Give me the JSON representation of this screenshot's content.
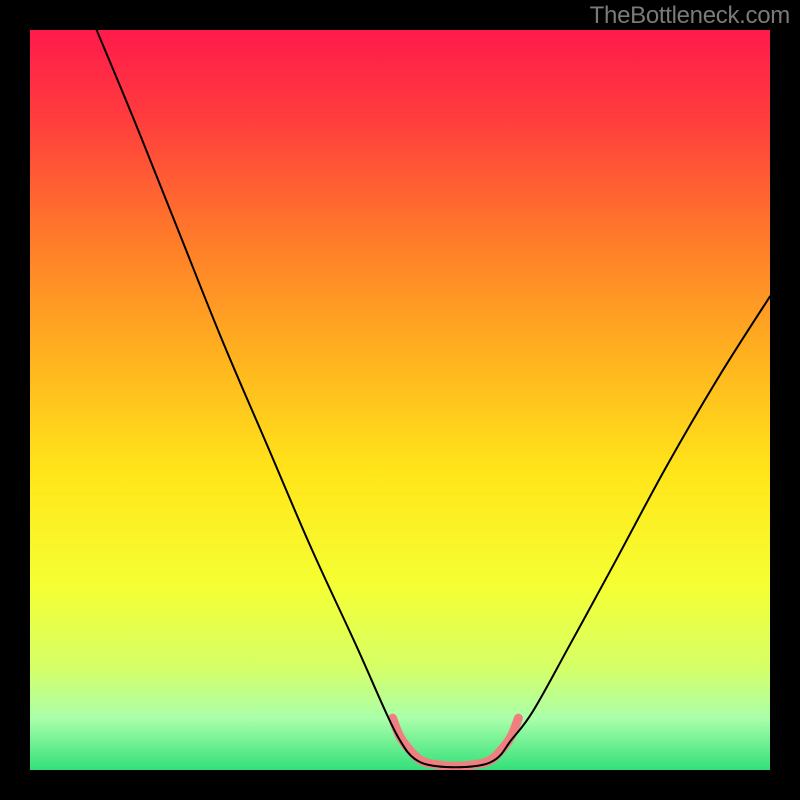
{
  "watermark": "TheBottleneck.com",
  "chart_data": {
    "type": "line",
    "title": "",
    "xlabel": "",
    "ylabel": "",
    "xlim": [
      0,
      100
    ],
    "ylim": [
      0,
      100
    ],
    "background_gradient": {
      "stops": [
        {
          "offset": 0.0,
          "color": "#ff1a4b"
        },
        {
          "offset": 0.12,
          "color": "#ff3d3d"
        },
        {
          "offset": 0.28,
          "color": "#ff7a2a"
        },
        {
          "offset": 0.44,
          "color": "#ffb21f"
        },
        {
          "offset": 0.6,
          "color": "#ffe61a"
        },
        {
          "offset": 0.75,
          "color": "#f5ff33"
        },
        {
          "offset": 0.86,
          "color": "#d6ff66"
        },
        {
          "offset": 0.93,
          "color": "#aaffaa"
        },
        {
          "offset": 1.0,
          "color": "#33e07a"
        }
      ]
    },
    "series": [
      {
        "name": "curve",
        "color": "#000000",
        "width": 2,
        "points": [
          {
            "x": 9.0,
            "y": 100.0
          },
          {
            "x": 14.0,
            "y": 88.0
          },
          {
            "x": 20.0,
            "y": 73.0
          },
          {
            "x": 26.0,
            "y": 58.0
          },
          {
            "x": 32.0,
            "y": 44.0
          },
          {
            "x": 38.0,
            "y": 30.0
          },
          {
            "x": 44.0,
            "y": 17.0
          },
          {
            "x": 48.0,
            "y": 8.0
          },
          {
            "x": 50.0,
            "y": 4.0
          },
          {
            "x": 52.0,
            "y": 1.5
          },
          {
            "x": 55.0,
            "y": 0.5
          },
          {
            "x": 60.0,
            "y": 0.5
          },
          {
            "x": 63.0,
            "y": 1.5
          },
          {
            "x": 65.0,
            "y": 4.0
          },
          {
            "x": 68.0,
            "y": 8.0
          },
          {
            "x": 73.0,
            "y": 17.0
          },
          {
            "x": 79.0,
            "y": 28.0
          },
          {
            "x": 86.0,
            "y": 41.0
          },
          {
            "x": 93.0,
            "y": 53.0
          },
          {
            "x": 100.0,
            "y": 64.0
          }
        ]
      },
      {
        "name": "bottom-marker",
        "color": "#f08080",
        "width": 9,
        "points": [
          {
            "x": 49.0,
            "y": 7.0
          },
          {
            "x": 50.0,
            "y": 4.5
          },
          {
            "x": 51.5,
            "y": 2.5
          },
          {
            "x": 53.0,
            "y": 1.2
          },
          {
            "x": 55.0,
            "y": 0.7
          },
          {
            "x": 57.5,
            "y": 0.5
          },
          {
            "x": 60.0,
            "y": 0.7
          },
          {
            "x": 62.0,
            "y": 1.2
          },
          {
            "x": 63.5,
            "y": 2.5
          },
          {
            "x": 65.0,
            "y": 4.5
          },
          {
            "x": 66.0,
            "y": 7.0
          }
        ]
      }
    ]
  }
}
